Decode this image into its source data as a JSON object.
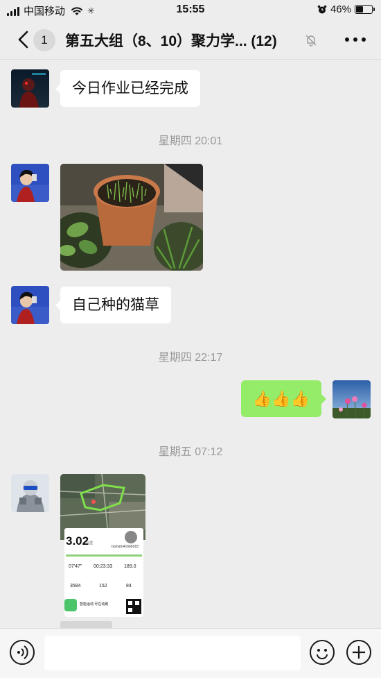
{
  "status_bar": {
    "carrier": "中国移动",
    "time": "15:55",
    "battery_percent": "46%",
    "battery_level": 0.46
  },
  "nav": {
    "unread_count": "1",
    "title": "第五大组（8、10）聚力学... (12)"
  },
  "messages": [
    {
      "type": "text",
      "direction": "incoming",
      "text": "今日作业已经完成"
    },
    {
      "type": "time",
      "text": "星期四 20:01"
    },
    {
      "type": "image",
      "direction": "incoming",
      "description": "plant-pot-photo"
    },
    {
      "type": "text",
      "direction": "incoming",
      "text": "自己种的猫草"
    },
    {
      "type": "time",
      "text": "星期四 22:17"
    },
    {
      "type": "text",
      "direction": "outgoing",
      "text": "👍👍👍"
    },
    {
      "type": "time",
      "text": "星期五 07:12"
    },
    {
      "type": "image",
      "direction": "incoming",
      "description": "running-record-screenshot"
    }
  ],
  "run_card": {
    "distance": "3.02",
    "distance_unit": "公里",
    "user": "bomam41666918",
    "pace": "07'47\"",
    "duration": "00:23:33",
    "stat3": "189.0",
    "steps": "3584",
    "stat5": "152",
    "stat6": "84",
    "app_name": "智能运动 尽在动跑"
  },
  "colors": {
    "background": "#ededed",
    "outgoing_bubble": "#95ec69",
    "incoming_bubble": "#ffffff",
    "time_text": "#999999"
  },
  "icons": {
    "back": "chevron-left-icon",
    "mute": "bell-slash-icon",
    "more": "ellipsis-icon",
    "voice": "voice-icon",
    "emoji": "smiley-icon",
    "plus": "plus-icon"
  },
  "input": {
    "placeholder": ""
  }
}
